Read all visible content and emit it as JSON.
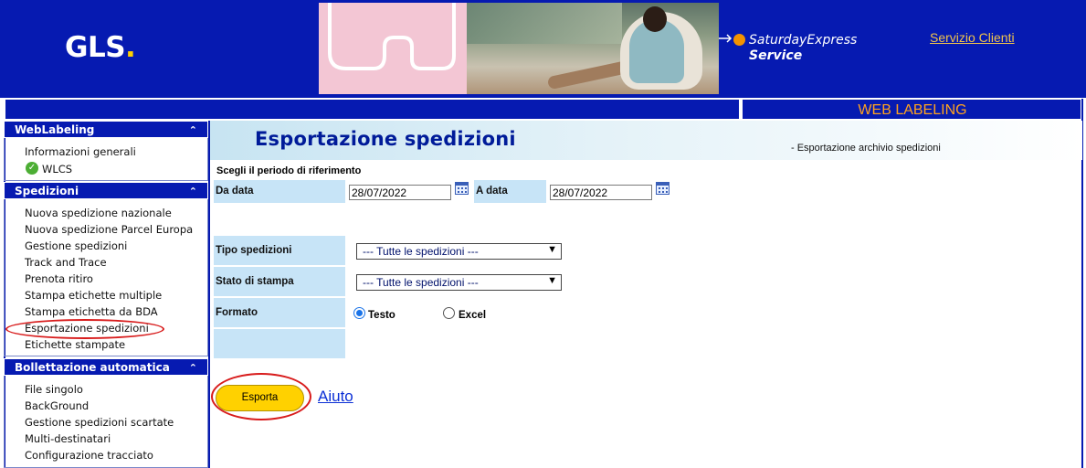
{
  "header": {
    "logo_text": "GLS",
    "logo_dot": ".",
    "banner_line1": "SaturdayExpress",
    "banner_line2": "Service",
    "customer_service_link": "Servizio Clienti",
    "strip_title": "WEB LABELING"
  },
  "sidebar": {
    "sections": [
      {
        "title": "WebLabeling",
        "items": [
          "Informazioni generali",
          "WLCS"
        ]
      },
      {
        "title": "Spedizioni",
        "items": [
          "Nuova spedizione nazionale",
          "Nuova spedizione Parcel Europa",
          "Gestione spedizioni",
          "Track and Trace",
          "Prenota ritiro",
          "Stampa etichette multiple",
          "Stampa etichetta da BDA",
          "Esportazione spedizioni",
          "Etichette stampate"
        ]
      },
      {
        "title": "Bollettazione automatica",
        "items": [
          "File singolo",
          "BackGround",
          "Gestione spedizioni scartate",
          "Multi-destinatari",
          "Configurazione tracciato"
        ]
      }
    ],
    "collapse_glyph": "⌃"
  },
  "main": {
    "title": "Esportazione spedizioni",
    "subtitle": "- Esportazione archivio spedizioni",
    "period_label": "Scegli il periodo di riferimento",
    "from_label": "Da data",
    "from_value": "28/07/2022",
    "to_label": "A data",
    "to_value": "28/07/2022",
    "shipment_type_label": "Tipo spedizioni",
    "shipment_type_value": "--- Tutte le spedizioni ---",
    "print_status_label": "Stato di stampa",
    "print_status_value": "--- Tutte le spedizioni ---",
    "format_label": "Formato",
    "format_options": [
      "Testo",
      "Excel"
    ],
    "format_selected": "Testo",
    "export_button": "Esporta",
    "help_link": "Aiuto"
  },
  "colors": {
    "brand_blue": "#061ab1",
    "brand_yellow": "#ffd100",
    "label_cell": "#c7e4f7",
    "annotation_red": "#d81c1c",
    "title_blue": "#001b99"
  }
}
